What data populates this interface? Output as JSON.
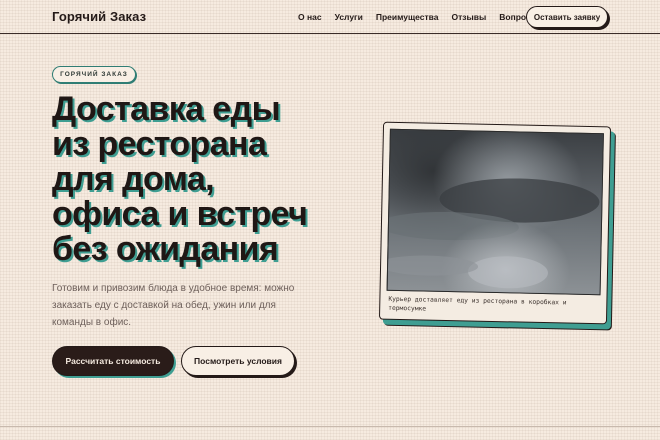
{
  "header": {
    "brand": "Горячий Заказ",
    "nav": [
      "О нас",
      "Услуги",
      "Преимущества",
      "Отзывы",
      "Вопросы"
    ],
    "cta": "Оставить заявку"
  },
  "hero": {
    "badge": "ГОРЯЧИЙ ЗАКАЗ",
    "headline_lines": [
      "Доставка еды",
      "из ресторана",
      "для дома,",
      "офиса и встреч",
      "без ожидания"
    ],
    "lead": "Готовим и привозим блюда в удобное время: можно заказать еду с доставкой на обед, ужин или для команды в офис.",
    "primary_button": "Рассчитать стоимость",
    "secondary_button": "Посмотреть условия"
  },
  "card": {
    "image_alt": "stormy-sky-photo",
    "caption": "Курьер доставляет еду из ресторана в коробках и термосумке"
  },
  "colors": {
    "background": "#f6ebe0",
    "ink": "#241a18",
    "accent_teal": "#3f9e92",
    "primary_button": "#2a1c19"
  }
}
